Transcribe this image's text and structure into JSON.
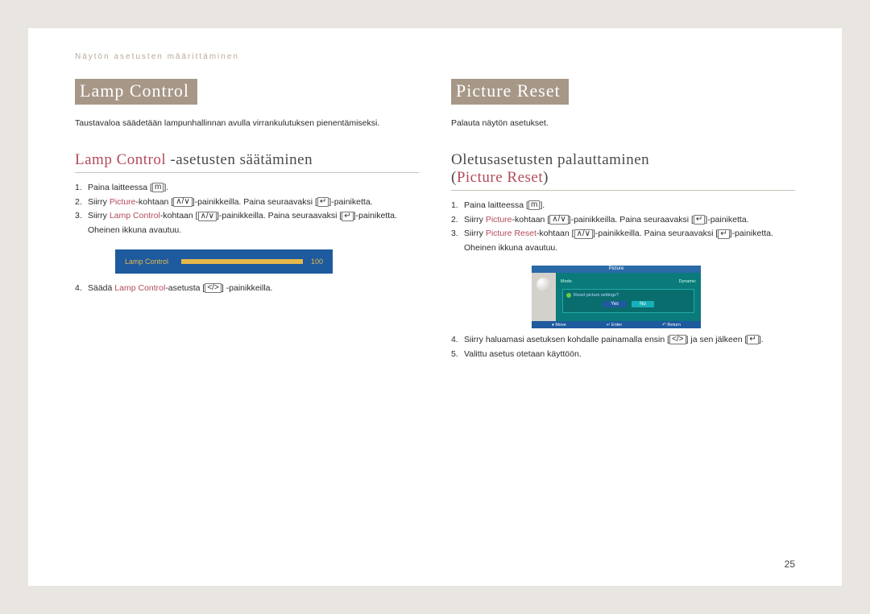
{
  "header": "Näytön asetusten määrittäminen",
  "page_number": "25",
  "left": {
    "tag": "Lamp Control",
    "intro": "Taustavaloa säädetään lampunhallinnan avulla virrankulutuksen pienentämiseksi.",
    "sub_hl": "Lamp Control",
    "sub_rest": " -asetusten säätäminen",
    "steps": {
      "s1_pre": "Paina laitteessa [",
      "s1_icon": "m",
      "s1_post": "].",
      "s2_a": "Siirry ",
      "s2_hl": "Picture",
      "s2_b": "-kohtaan [",
      "s2_icon1": "∧/∨",
      "s2_c": "]-painikkeilla. Paina seuraavaksi [",
      "s2_icon2": "↵",
      "s2_d": "]-painiketta.",
      "s3_a": "Siirry ",
      "s3_hl": "Lamp Control",
      "s3_b": "-kohtaan [",
      "s3_icon1": "∧/∨",
      "s3_c": "]-painikkeilla. Paina seuraavaksi [",
      "s3_icon2": "↵",
      "s3_d": "]-painiketta. Oheinen ikkuna avautuu.",
      "s4_a": "Säädä ",
      "s4_hl": "Lamp Control",
      "s4_b": "-asetusta [",
      "s4_icon": "</>",
      "s4_c": "] -painikkeilla."
    },
    "osd": {
      "label": "Lamp Control",
      "value": "100"
    }
  },
  "right": {
    "tag": "Picture Reset",
    "intro": "Palauta näytön asetukset.",
    "sub_line1": "Oletusasetusten palauttaminen",
    "sub_lparen": "(",
    "sub_hl": "Picture Reset",
    "sub_rparen": ")",
    "steps": {
      "s1_pre": "Paina laitteessa [",
      "s1_icon": "m",
      "s1_post": "].",
      "s2_a": "Siirry ",
      "s2_hl": "Picture",
      "s2_b": "-kohtaan [",
      "s2_icon1": "∧/∨",
      "s2_c": "]-painikkeilla. Paina seuraavaksi [",
      "s2_icon2": "↵",
      "s2_d": "]-painiketta.",
      "s3_a": "Siirry ",
      "s3_hl": "Picture Reset",
      "s3_b": "-kohtaan [",
      "s3_icon1": "∧/∨",
      "s3_c": "]-painikkeilla. Paina seuraavaksi [",
      "s3_icon2": "↵",
      "s3_d": "]-painiketta. Oheinen ikkuna avautuu.",
      "s4_a": "Siirry haluamasi asetuksen kohdalle painamalla ensin [",
      "s4_icon1": "</>",
      "s4_b": "] ja sen jälkeen [",
      "s4_icon2": "↵",
      "s4_c": "].",
      "s5": "Valittu asetus otetaan käyttöön."
    },
    "osd": {
      "title": "Picture",
      "menu_a": "Mode",
      "menu_b": "Dynamic",
      "msg": "Reset picture settings?",
      "yes": "Yes",
      "no": "No",
      "foot_a": "Move",
      "foot_b": "Enter",
      "foot_c": "Return"
    }
  }
}
